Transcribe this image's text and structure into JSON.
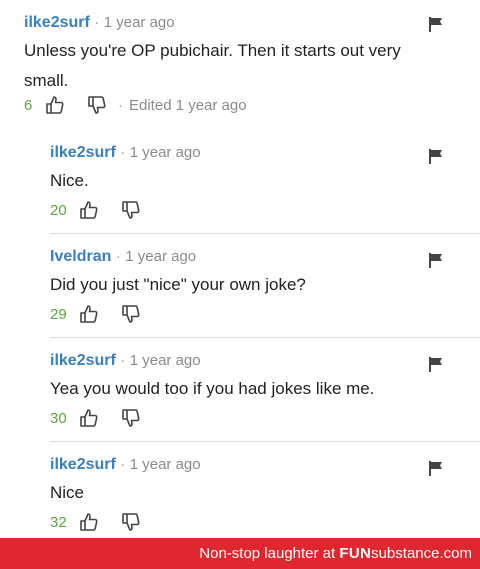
{
  "comments": [
    {
      "user": "ilke2surf",
      "time": "1 year ago",
      "text": "Unless you're OP pubichair. Then it starts out very small.",
      "score": "6",
      "edited": "Edited 1 year ago"
    },
    {
      "user": "ilke2surf",
      "time": "1 year ago",
      "text": "Nice.",
      "score": "20"
    },
    {
      "user": "Iveldran",
      "time": "1 year ago",
      "text": "Did you just \"nice\" your own joke?",
      "score": "29"
    },
    {
      "user": "ilke2surf",
      "time": "1 year ago",
      "text": "Yea you would too if you had jokes like me.",
      "score": "30"
    },
    {
      "user": "ilke2surf",
      "time": "1 year ago",
      "text": "Nice",
      "score": "32"
    }
  ],
  "separator": "·",
  "footer": {
    "text": "Non-stop laughter at ",
    "brand_bold": "FUN",
    "brand_rest": "substance",
    "domain": ".com"
  },
  "colors": {
    "username": "#3a7fc0",
    "score": "#5aa63a",
    "footer_bg": "#e0262e"
  },
  "icons": [
    "flag-icon",
    "thumbs-up-icon",
    "thumbs-down-icon"
  ]
}
